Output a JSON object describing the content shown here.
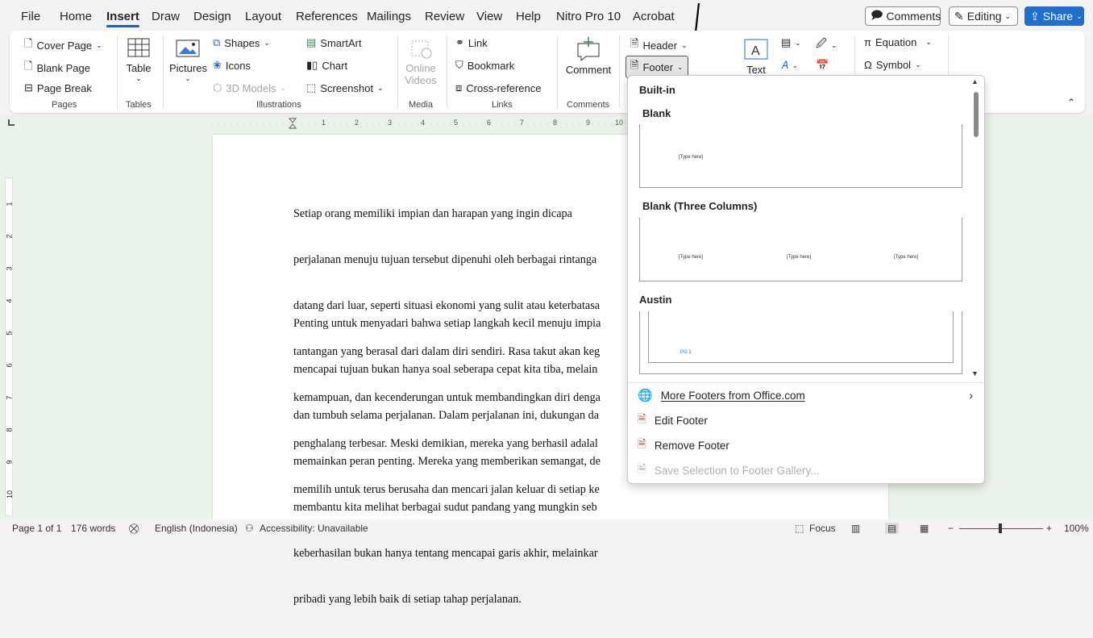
{
  "menubar": {
    "items": [
      "File",
      "Home",
      "Insert",
      "Draw",
      "Design",
      "Layout",
      "References",
      "Mailings",
      "Review",
      "View",
      "Help",
      "Nitro Pro 10",
      "Acrobat"
    ],
    "comments_label": "Comments",
    "editing_label": "Editing",
    "share_label": "Share"
  },
  "ribbon": {
    "pages": {
      "cover": "Cover Page",
      "blank": "Blank Page",
      "break": "Page Break",
      "label": "Pages"
    },
    "tables": {
      "table": "Table",
      "label": "Tables"
    },
    "illustrations": {
      "pictures": "Pictures",
      "shapes": "Shapes",
      "icons": "Icons",
      "models": "3D Models",
      "smartart": "SmartArt",
      "chart": "Chart",
      "screenshot": "Screenshot",
      "label": "Illustrations"
    },
    "media": {
      "online": "Online",
      "videos": "Videos",
      "label": "Media"
    },
    "links": {
      "link": "Link",
      "bookmark": "Bookmark",
      "crossref": "Cross-reference",
      "label": "Links"
    },
    "comments": {
      "comment": "Comment",
      "label": "Comments"
    },
    "headerfooter": {
      "header": "Header",
      "footer": "Footer"
    },
    "text": {
      "text": "Text"
    },
    "symbols": {
      "equation": "Equation",
      "symbol": "Symbol"
    }
  },
  "document": {
    "para1": [
      "Setiap orang memiliki impian dan harapan yang ingin dicapa",
      "perjalanan menuju tujuan tersebut dipenuhi oleh berbagai rintanga",
      "datang dari luar, seperti situasi ekonomi yang sulit atau keterbatasa",
      "tantangan yang berasal dari dalam diri sendiri. Rasa takut akan keg",
      "kemampuan, dan kecenderungan untuk membandingkan diri denga",
      "penghalang terbesar. Meski demikian, mereka yang berhasil adalal",
      "memilih untuk terus berusaha dan mencari jalan keluar di setiap ke"
    ],
    "para2": [
      "Penting untuk menyadari bahwa setiap langkah kecil menuju impia",
      "mencapai tujuan bukan hanya soal seberapa cepat kita tiba, melain",
      "dan tumbuh selama perjalanan. Dalam perjalanan ini, dukungan da",
      "memainkan peran penting. Mereka yang memberikan semangat, de",
      "membantu kita melihat berbagai sudut pandang yang mungkin seb",
      "keberhasilan bukan hanya tentang mencapai garis akhir, melainkar",
      "pribadi yang lebih baik di setiap tahap perjalanan."
    ]
  },
  "dropdown": {
    "section": "Built-in",
    "items": [
      {
        "name": "Blank",
        "placeholders": [
          "[Type here]"
        ]
      },
      {
        "name": "Blank (Three Columns)",
        "placeholders": [
          "[Type here]",
          "[Type here]",
          "[Type here]"
        ]
      },
      {
        "name": "Austin",
        "placeholders": [
          "PG 1"
        ]
      }
    ],
    "more": "More Footers from Office.com",
    "edit": "Edit Footer",
    "remove": "Remove Footer",
    "save": "Save Selection to Footer Gallery..."
  },
  "ruler": {
    "numbers": [
      "1",
      "2",
      "3",
      "4",
      "5",
      "6",
      "7",
      "8",
      "9",
      "10"
    ]
  },
  "vruler": {
    "numbers": [
      "1",
      "2",
      "3",
      "4",
      "5",
      "6",
      "7",
      "8",
      "9",
      "10"
    ]
  },
  "status": {
    "page": "Page 1 of 1",
    "words": "176 words",
    "language": "English (Indonesia)",
    "accessibility": "Accessibility: Unavailable",
    "focus": "Focus",
    "zoom": "100%"
  },
  "colors": {
    "accent": "#1e6fd0",
    "doc_bg": "#eaf3e9"
  }
}
